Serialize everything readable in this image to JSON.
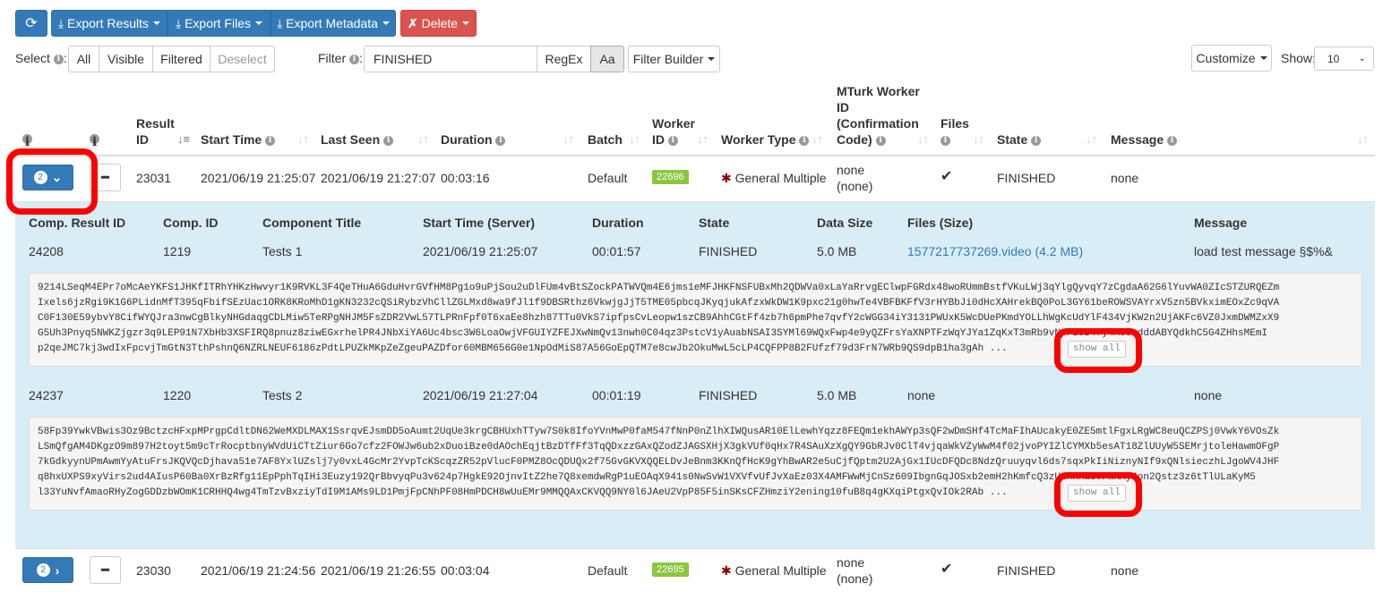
{
  "toolbar": {
    "export_results": "Export Results",
    "export_files": "Export Files",
    "export_metadata": "Export Metadata",
    "delete": "Delete",
    "customize": "Customize",
    "show_label": "Show:",
    "show_value": "10"
  },
  "select": {
    "label": "Select",
    "all": "All",
    "visible": "Visible",
    "filtered": "Filtered",
    "deselect": "Deselect"
  },
  "filter": {
    "label": "Filter",
    "value": "FINISHED",
    "regex": "RegEx",
    "case": "Aa",
    "builder": "Filter Builder"
  },
  "columns": {
    "result_id": "Result ID",
    "start_time": "Start Time",
    "last_seen": "Last Seen",
    "duration": "Duration",
    "batch": "Batch",
    "worker_id": "Worker ID",
    "worker_type": "Worker Type",
    "mturk": "MTurk Worker ID (Confirmation Code)",
    "files": "Files",
    "state": "State",
    "message": "Message"
  },
  "rows": [
    {
      "count": "2",
      "result_id": "23031",
      "start_time": "2021/06/19 21:25:07",
      "last_seen": "2021/06/19 21:27:07",
      "duration": "00:03:16",
      "batch": "Default",
      "worker_id": "22696",
      "worker_type": "General Multiple",
      "mturk": "none",
      "mturk_code": "(none)",
      "state": "FINISHED",
      "message": "none",
      "expanded": true
    },
    {
      "count": "2",
      "result_id": "23030",
      "start_time": "2021/06/19 21:24:56",
      "last_seen": "2021/06/19 21:26:55",
      "duration": "00:03:04",
      "batch": "Default",
      "worker_id": "22695",
      "worker_type": "General Multiple",
      "mturk": "none",
      "mturk_code": "(none)",
      "state": "FINISHED",
      "message": "none",
      "expanded": false
    }
  ],
  "sub_columns": {
    "comp_result_id": "Comp. Result ID",
    "comp_id": "Comp. ID",
    "title": "Component Title",
    "start_time": "Start Time (Server)",
    "duration": "Duration",
    "state": "State",
    "data_size": "Data Size",
    "files": "Files (Size)",
    "message": "Message"
  },
  "components": [
    {
      "comp_result_id": "24208",
      "comp_id": "1219",
      "title": "Tests 1",
      "start_time": "2021/06/19 21:25:07",
      "duration": "00:01:57",
      "state": "FINISHED",
      "data_size": "5.0 MB",
      "files": "1577217737269.video (4.2 MB)",
      "message": "load test message §$%&",
      "data_lines": [
        "9214LSeqM4EPr7oMcAeYKFS1JHKfITRhYHKzHwvyr1K9RVKL3F4QeTHuA6GduHvrGVfHM8Pg1o9uPjSou2uDlFUm4vBtSZockPATWVQm4E6jms1eMFJHKFNSFUBxMh2QDWVa0xLaYaRrvgEClwpFGRdx48woRUmmBstfVKuLWj3qYlgQyvqY7zCgdaA62G6lYuvWA0ZIcSTZURQEZm",
        "Ixels6jzRgi9K1G6PLidnMfT395qFbifSEzUac1ORK8KRoMhD1gKN3232cQSiRybzVhCllZGLMxd8wa9fJl1f9DBSRthz6VkwjgJjT5TME05pbcqJKyqjukAfzxWkDW1K9pxc21g0hwTe4VBFBKFfV3rHYBbJi0dHcXAHrekBQ0PoL3GY61beROWSVAYrxV5zn5BVkximEOxZc9qVA",
        "C0F130E59ybvY8CifWYQJra3nwCgBlkyNHGdaqgCDLMiw5TeRPgNHJM5FsZDR2VwL57TLPRnFpf0T6xaEe8hzh87TTu0VkS7ipfpsCvLeopw1szCB9AhhCGtFf4zb7h6pmPhe7qvfY2cWGG34iY3131PWUxK5WcDUePKmdYOLLhWgKcUdYlF434VjKW2n2UjAKFc6VZ0JxmDWMZxX9",
        "G5Uh3Pnyq5NWKZjgzr3q9LEP91N7XbHb3XSFIRQ8pnuz8ziwEGxrhelPR4JNbXiYA6Uc4bsc3W6LoaOwjVFGUIYZFEJXwNmQv13nwh0C04qz3PstcV1yAuabNSAI3SYMl69WQxFwp4e9yQZFrsYaXNPTFzWqYJYa1ZqKxT3mRb9vNpPisB4fy4A00mdddABYQdkhC5G4ZHhsMEmI",
        "p2qeJMC7kj3wdIxFpcvjTmGtN3TthPshnQ6NZRLNEUF6186zPdtLPUZkMKpZeZgeuPAZDfor60MBM656G0e1NpOdMiS87A56GoEpQTM7e8cwJb2OkuMwL5cLP4CQFPP8B2FUfzf79d3FrN7WRb9QS9dpB1ha3gAh"
      ],
      "ellipsis": "...",
      "show_all": "show all"
    },
    {
      "comp_result_id": "24237",
      "comp_id": "1220",
      "title": "Tests 2",
      "start_time": "2021/06/19 21:27:04",
      "duration": "00:01:19",
      "state": "FINISHED",
      "data_size": "5.0 MB",
      "files": "none",
      "message": "none",
      "data_lines": [
        "58Fp39YwkVBwis3Oz9BctzcHFxpMPrgpCdltDN62WeMXDLMAX1SsrqvEJsmDD5oAumt2UqUe3krgCBHUxhTTyw7S0k8IfoYVnMwP0faM547fNnP0nZlhXIWQusAR10ElLewhYqzz8FEQm1ekhAWYp3sQF2wDmSHf4TcMaFIhAUcakyE0ZE5mtlFgxLRgWC8euQCZPSj0VwkY6VOsZk",
        "LSmQfgAM4DKgzO9m897H2toyt5m9cTrRocptbnyWVdUiCTtZiur6Go7cfz2FOWJw6ub2xDuoiBze0dAOchEqjtBzDTfFf3TqQDxzzGAxQZodZJAGSXHjX3gkVUf0qHx7R4SAuXzXgQY9GbRJv0ClT4vjqaWkVZyWwM4f02jvoPYIZlCYMXb5esAT18ZlUUyW5SEMrjtoleHawmOFgP",
        "7kGdkyynUPmAwmYyAtuFrsJKQVQcDjhava51e7AF8YxlUZslj7y0vxL4GcMr2YvpTcKScqzZR52pVlucF0PMZ8OcQDUQx2f75GvGKVXQQELDvJeBnm3KKnQfHcK9gYhBwAR2e5uCjfQptm2U2AjGx1IUcDFQDc8NdzQruuyqvl6ds7sqxPkIiNiznyNIf9xQNlsieczhLJgoWV4JHF",
        "q8hxUXPS9xyVirs2ud4AIusP60Ba0XrBzRfg11EpPphTqIHi3Euzy192QrBbvyqPu3v624p7HgkE92OjnvItZ2he7Q8xemdwRgP1uEOAqX941s0NwSvW1VXVfvUfJvXaEz03X4AMFWwMjCnSz609IbgnGqJOSxb2emH2hKmfcQ3zULnMMa9vPWXAy4on2Qstz3z6tTlULaKyM5",
        "l33YuNvfAmaoRHyZogGDDzbWOmK1CRHHQ4wg4TmTzvBxziyTdI9M1AMs9LD1PmjFpCNhPF08HmPDCH8wUuEMr9MMQQAxCKVQQ9NY0l6JAeU2VpP85F5inSKsCFZHmziY2ening10fuB8q4gKXqiPtgxQvIOk2RAb"
      ],
      "ellipsis": "...",
      "show_all": "show all"
    }
  ],
  "colors": {
    "primary": "#337ab7",
    "danger": "#d9534f",
    "worker_badge": "#8cc63f",
    "expanded_bg": "#d9edf7",
    "highlight": "#ff0000",
    "link": "#337ab7"
  }
}
